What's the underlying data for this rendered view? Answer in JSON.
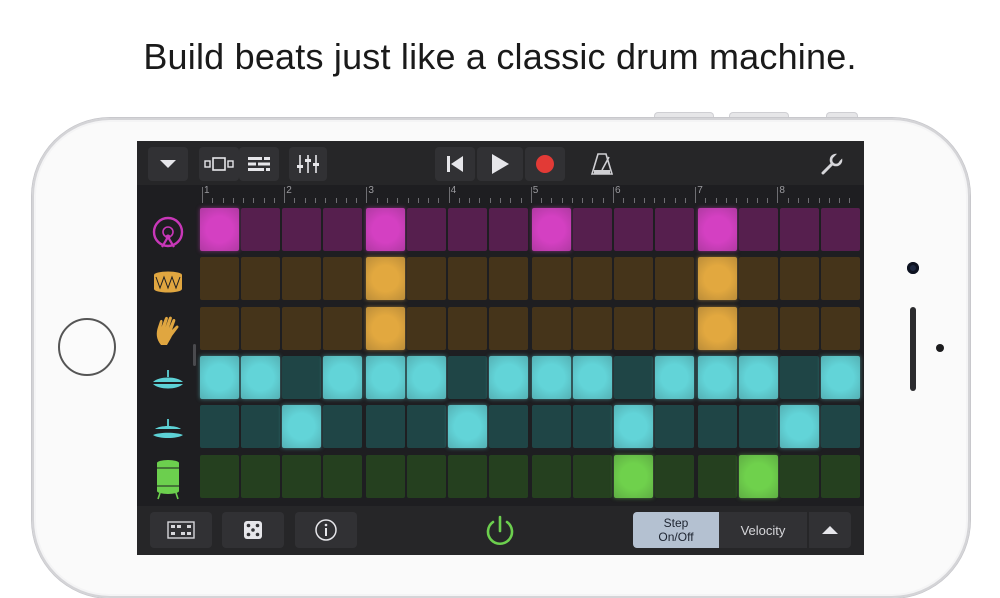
{
  "headline": "Build beats just like a classic drum machine.",
  "ruler": {
    "bars": [
      "1",
      "2",
      "3",
      "4",
      "5",
      "6",
      "7",
      "8"
    ]
  },
  "toolbar": {
    "icons": [
      "chevron-down-icon",
      "track-view-icon",
      "tracks-list-icon",
      "mixer-icon",
      "rewind-icon",
      "play-icon",
      "record-icon",
      "metronome-icon",
      "wrench-icon"
    ]
  },
  "instruments": [
    {
      "name": "kick-drum",
      "icon": "kick-drum-icon",
      "color": "#c837b8"
    },
    {
      "name": "snare-drum",
      "icon": "snare-drum-icon",
      "color": "#e0a640"
    },
    {
      "name": "hand-clap",
      "icon": "hand-clap-icon",
      "color": "#e0a640"
    },
    {
      "name": "closed-hihat",
      "icon": "closed-hihat-icon",
      "color": "#5dd2d6"
    },
    {
      "name": "open-hihat",
      "icon": "open-hihat-icon",
      "color": "#5dd2d6"
    },
    {
      "name": "floor-tom",
      "icon": "floor-tom-icon",
      "color": "#6ccf4e"
    }
  ],
  "pattern": [
    [
      1,
      0,
      0,
      0,
      1,
      0,
      0,
      0,
      1,
      0,
      0,
      0,
      1,
      0,
      0,
      0
    ],
    [
      0,
      0,
      0,
      0,
      1,
      0,
      0,
      0,
      0,
      0,
      0,
      0,
      1,
      0,
      0,
      0
    ],
    [
      0,
      0,
      0,
      0,
      1,
      0,
      0,
      0,
      0,
      0,
      0,
      0,
      1,
      0,
      0,
      0
    ],
    [
      1,
      1,
      0,
      1,
      1,
      1,
      0,
      1,
      1,
      1,
      0,
      1,
      1,
      1,
      0,
      1
    ],
    [
      0,
      0,
      1,
      0,
      0,
      0,
      1,
      0,
      0,
      0,
      1,
      0,
      0,
      0,
      1,
      0
    ],
    [
      0,
      0,
      0,
      0,
      0,
      0,
      0,
      0,
      0,
      0,
      1,
      0,
      0,
      1,
      0,
      0
    ]
  ],
  "colors": {
    "row_off": [
      "#561f4e",
      "#45341a",
      "#45341a",
      "#1f4546",
      "#1f4546",
      "#25401f"
    ],
    "row_on": [
      "#d440c2",
      "#e2a83f",
      "#e2a83f",
      "#62d4d8",
      "#62d4d8",
      "#6fd14c"
    ],
    "power": "#6ccf4e",
    "record": "#e23a36"
  },
  "bottombar": {
    "step_label_line1": "Step",
    "step_label_line2": "On/Off",
    "velocity_label": "Velocity"
  }
}
